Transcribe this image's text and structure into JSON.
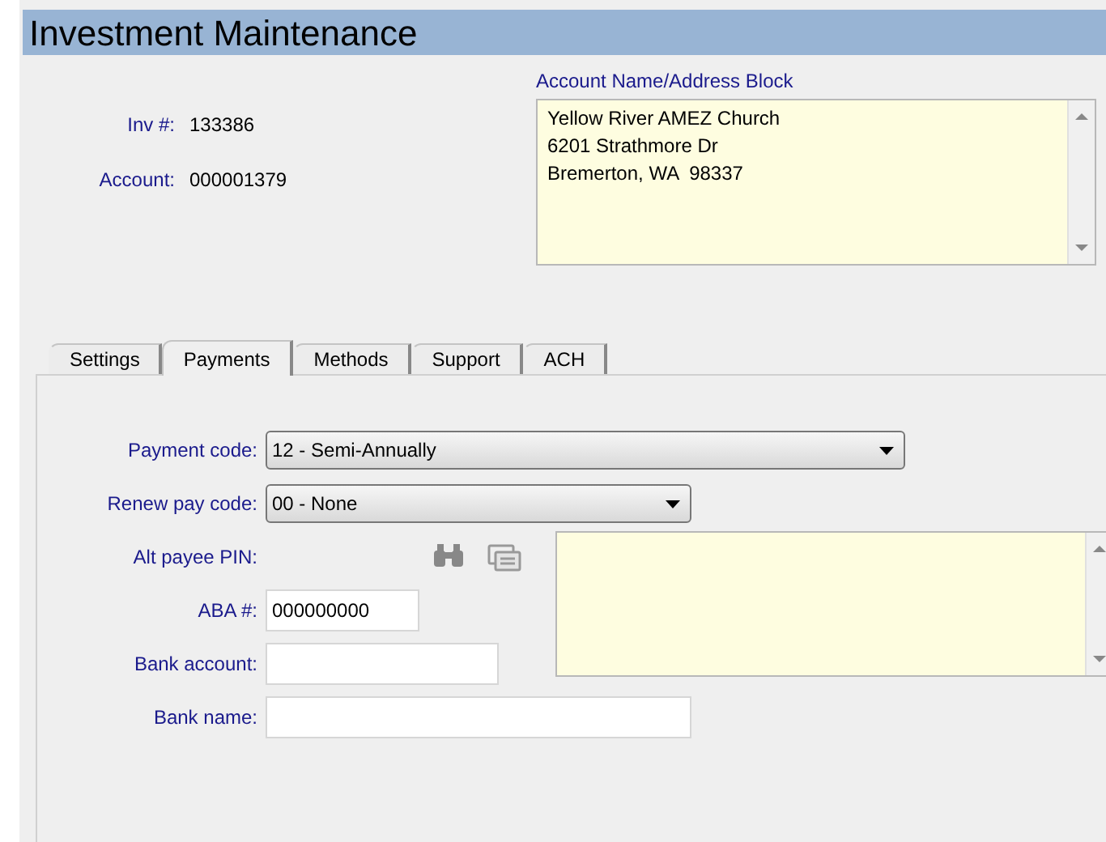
{
  "window": {
    "title": "Investment Maintenance"
  },
  "header": {
    "fields": [
      {
        "label": "Inv #:",
        "value": "133386"
      },
      {
        "label": "Account:",
        "value": "000001379"
      }
    ],
    "address": {
      "label": "Account Name/Address Block",
      "lines": [
        "Yellow River AMEZ Church",
        "6201 Strathmore Dr",
        "Bremerton, WA  98337"
      ]
    }
  },
  "tabs": [
    {
      "label": "Settings",
      "selected": false
    },
    {
      "label": "Payments",
      "selected": true
    },
    {
      "label": "Methods",
      "selected": false
    },
    {
      "label": "Support",
      "selected": false
    },
    {
      "label": "ACH",
      "selected": false
    }
  ],
  "payments": {
    "fields": [
      {
        "kind": "dropdown",
        "label": "Payment code:",
        "value": "12 - Semi-Annually"
      },
      {
        "kind": "dropdown",
        "label": "Renew pay code:",
        "value": "00 - None"
      },
      {
        "kind": "lookup",
        "label": "Alt payee PIN:"
      },
      {
        "kind": "text",
        "label": "ABA #:",
        "value": "000000000"
      },
      {
        "kind": "text",
        "label": "Bank account:"
      },
      {
        "kind": "text",
        "label": "Bank name:"
      }
    ]
  }
}
